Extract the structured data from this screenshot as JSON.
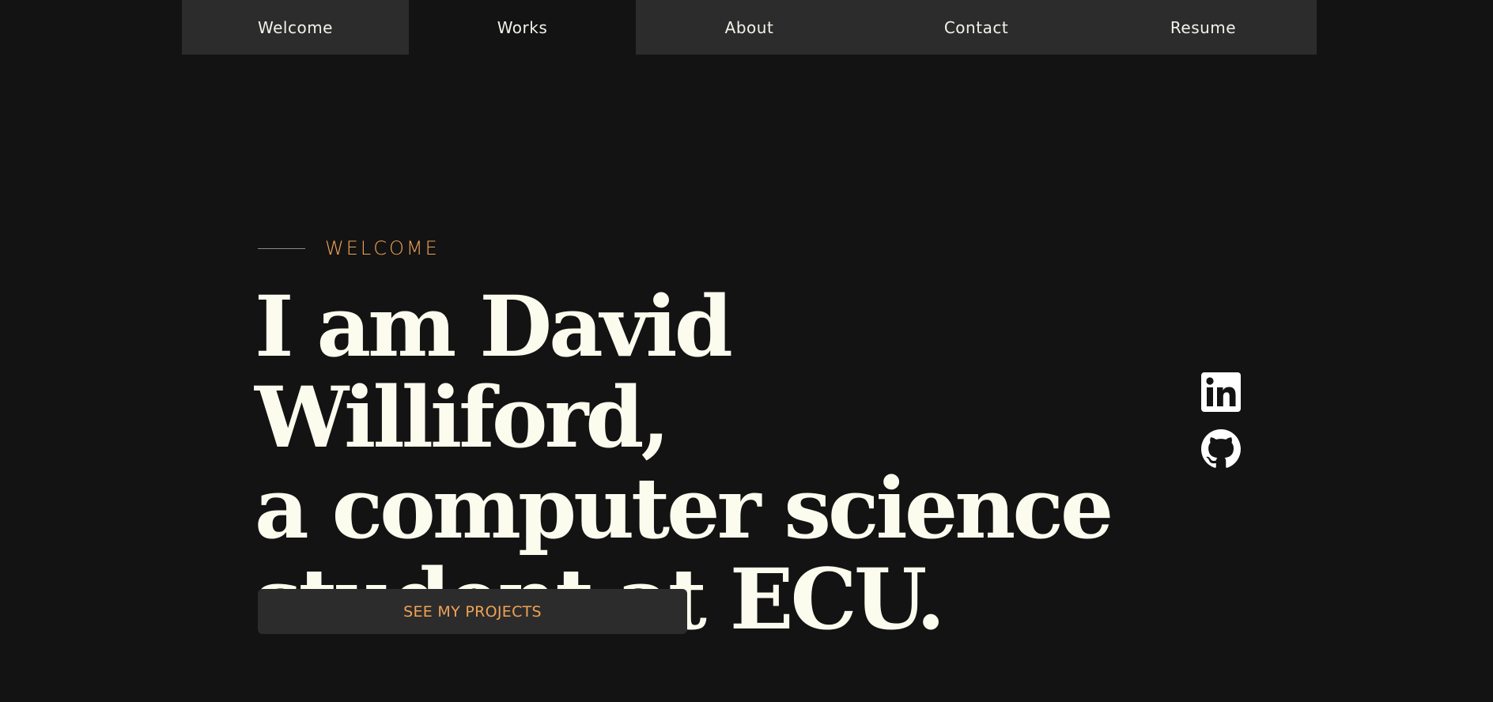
{
  "nav": {
    "items": [
      {
        "label": "Welcome",
        "active": false
      },
      {
        "label": "Works",
        "active": true
      },
      {
        "label": "About",
        "active": false
      },
      {
        "label": "Contact",
        "active": false
      },
      {
        "label": "Resume",
        "active": false
      }
    ]
  },
  "hero": {
    "eyebrow": "WELCOME",
    "headline_line1": "I am David Williford,",
    "headline_line2": "a computer science",
    "headline_line3": "student at ECU.",
    "cta_label": "SEE MY PROJECTS"
  },
  "social": {
    "icons": [
      "linkedin-icon",
      "github-icon"
    ]
  },
  "colors": {
    "background": "#131313",
    "panel": "#2c2c2c",
    "accent": "#f0a255",
    "headline": "#fbfbee"
  }
}
